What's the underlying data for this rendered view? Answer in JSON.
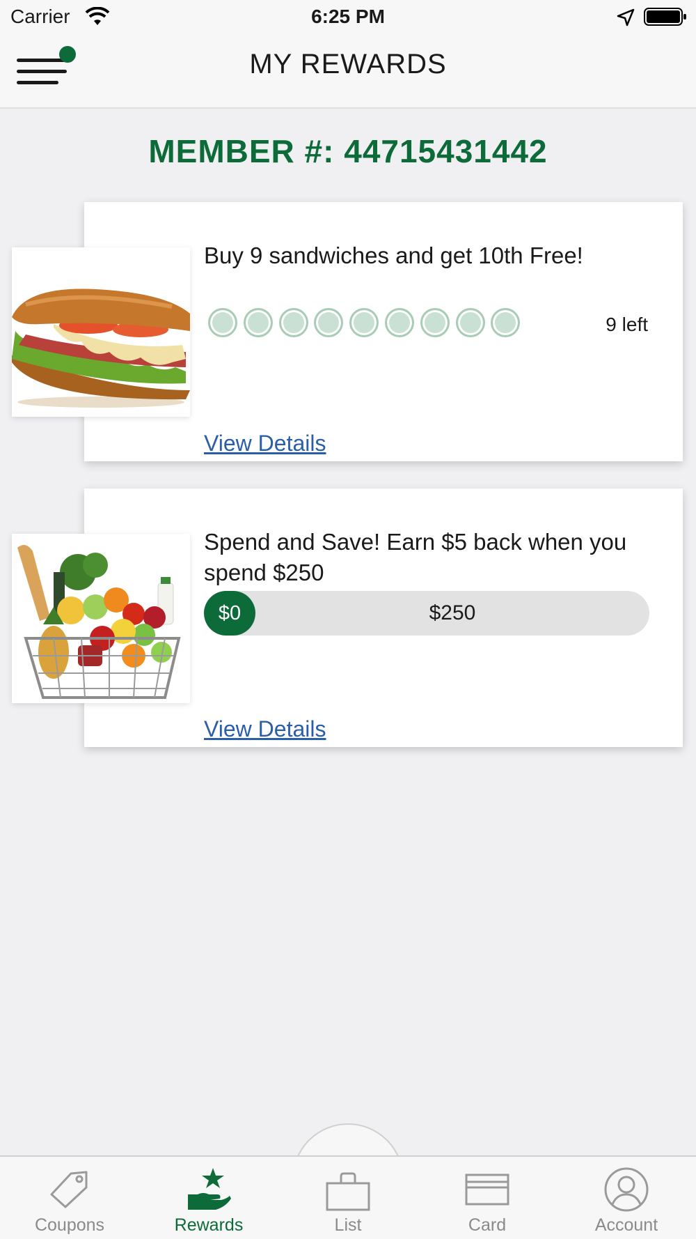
{
  "status_bar": {
    "carrier": "Carrier",
    "time": "6:25 PM"
  },
  "header": {
    "title": "MY REWARDS"
  },
  "member": {
    "text": "MEMBER #: 44715431442"
  },
  "rewards": [
    {
      "title": "Buy 9 sandwiches and get 10th Free!",
      "stamps_total": 9,
      "stamps_filled": 0,
      "remaining_label": "9 left",
      "link_label": "View Details",
      "image_icon": "sandwich-image"
    },
    {
      "title": "Spend and Save! Earn $5 back when you spend $250",
      "current_label": "$0",
      "goal_label": "$250",
      "progress_fraction": 0,
      "link_label": "View Details",
      "image_icon": "grocery-basket-image"
    }
  ],
  "tabs": [
    {
      "label": "Coupons",
      "icon": "tag-icon",
      "active": false
    },
    {
      "label": "Rewards",
      "icon": "rewards-hand-star-icon",
      "active": true
    },
    {
      "label": "List",
      "icon": "bag-icon",
      "active": false
    },
    {
      "label": "Card",
      "icon": "card-icon",
      "active": false
    },
    {
      "label": "Account",
      "icon": "account-icon",
      "active": false
    }
  ],
  "colors": {
    "brand_green": "#0d6b3a",
    "link_blue": "#2a5ea8",
    "stamp_fill": "#c8e1d4",
    "notification_dot": "#0d6b3a"
  }
}
